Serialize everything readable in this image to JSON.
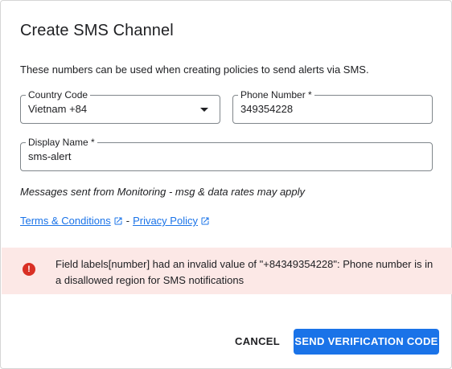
{
  "dialog": {
    "title": "Create SMS Channel",
    "description": "These numbers can be used when creating policies to send alerts via SMS."
  },
  "country_code": {
    "label": "Country Code",
    "value": "Vietnam +84"
  },
  "phone_number": {
    "label": "Phone Number *",
    "value": "349354228"
  },
  "display_name": {
    "label": "Display Name *",
    "value": "sms-alert"
  },
  "note": "Messages sent from Monitoring - msg & data rates may apply",
  "links": {
    "terms": "Terms & Conditions",
    "separator": "-",
    "privacy": "Privacy Policy",
    "icon": "open-in-new-icon"
  },
  "error": {
    "icon": "error-icon",
    "message": "Field labels[number] had an invalid value of \"+84349354228\": Phone number is in a disallowed region for SMS notifications"
  },
  "buttons": {
    "cancel": "CANCEL",
    "send": "SEND VERIFICATION CODE"
  },
  "colors": {
    "primary": "#1a73e8",
    "error": "#d93025",
    "error_bg": "#fce8e6"
  }
}
